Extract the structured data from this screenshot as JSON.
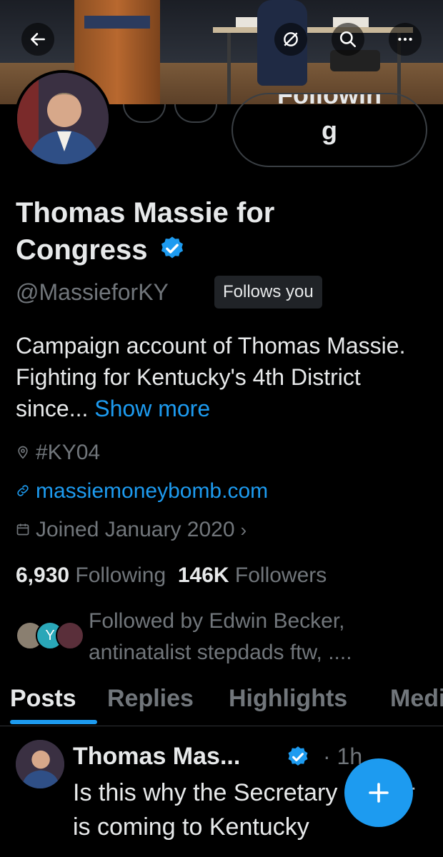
{
  "profile": {
    "name": "Thomas Massie for Congress",
    "handle": "@MassieforKY",
    "follows_you": "Follows you",
    "follow_button": "Following",
    "bio": "Campaign account of Thomas Massie. Fighting for Kentucky's 4th District since...",
    "show_more": "Show more",
    "location": "#KY04",
    "website": "massiemoneybomb.com",
    "joined": "Joined January 2020",
    "following_count": "6,930",
    "following_label": "Following",
    "followers_count": "146K",
    "followers_label": "Followers",
    "followed_by": "Followed by Edwin Becker, antinatalist stepdads ftw, ...."
  },
  "tabs": [
    "Posts",
    "Replies",
    "Highlights",
    "Media"
  ],
  "post": {
    "author": "Thomas Mas...",
    "time": "· 1h",
    "text": "Is this why the Secretary of War is coming to Kentucky"
  },
  "colors": {
    "accent": "#1d9bf0",
    "background": "#000000",
    "muted": "#71767b"
  },
  "icons": {
    "back": "arrow-left-icon",
    "grok": "grok-icon",
    "search": "search-icon",
    "more": "more-icon",
    "verified": "verified-badge-icon",
    "location": "location-icon",
    "link": "link-icon",
    "calendar": "calendar-icon",
    "compose": "plus-icon"
  }
}
